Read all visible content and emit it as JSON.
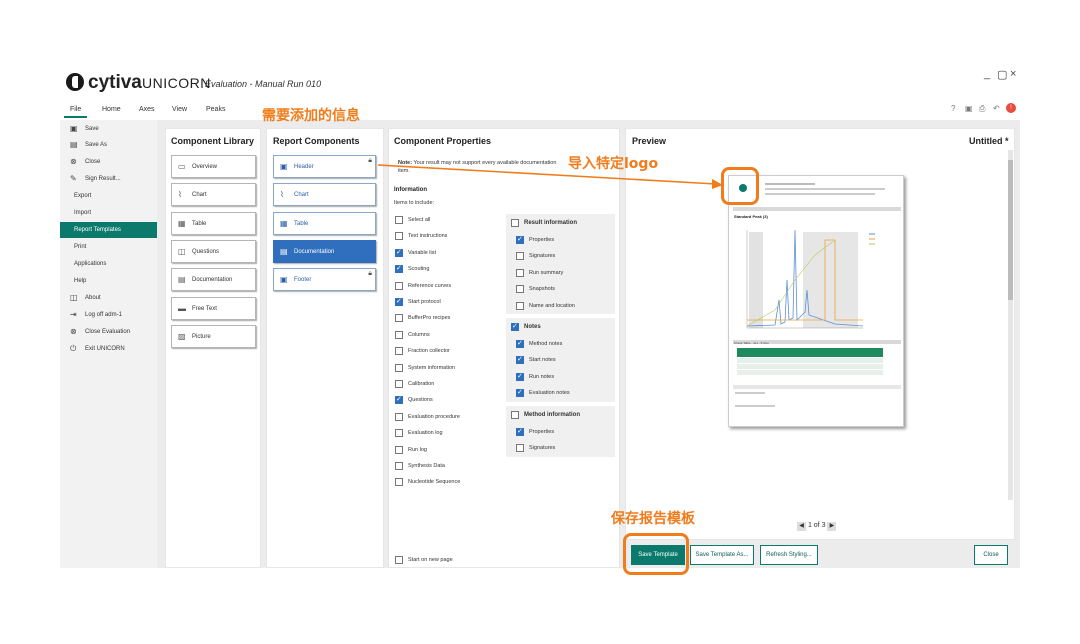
{
  "app": {
    "brand": "cytiva",
    "product": "UNICORN",
    "window_title": "Evaluation - Manual Run  010",
    "window_controls": [
      "_",
      "▢",
      "×"
    ]
  },
  "menu": [
    "File",
    "Home",
    "Axes",
    "View",
    "Peaks"
  ],
  "sidebar": [
    {
      "label": "Save",
      "icon": "save-icon"
    },
    {
      "label": "Save As",
      "icon": "save-as-icon"
    },
    {
      "label": "Close",
      "icon": "close-circle-icon"
    },
    {
      "label": "Sign Result...",
      "icon": "pen-icon"
    },
    {
      "label": "Export",
      "icon": ""
    },
    {
      "label": "Import",
      "icon": ""
    },
    {
      "label": "Report Templates",
      "icon": "",
      "active": true
    },
    {
      "label": "Print",
      "icon": ""
    },
    {
      "label": "Applications",
      "icon": ""
    },
    {
      "label": "Help",
      "icon": ""
    },
    {
      "label": "About",
      "icon": "about-icon"
    },
    {
      "label": "Log off adm-1",
      "icon": "logoff-icon"
    },
    {
      "label": "Close Evaluation",
      "icon": "close-circle-icon"
    },
    {
      "label": "Exit UNICORN",
      "icon": "power-icon"
    }
  ],
  "component_library": {
    "title": "Component Library",
    "items": [
      "Overview",
      "Chart",
      "Table",
      "Questions",
      "Documentation",
      "Free Text",
      "Picture"
    ]
  },
  "report_components": {
    "title": "Report Components",
    "items": [
      "Header",
      "Chart",
      "Table",
      "Documentation",
      "Footer"
    ]
  },
  "component_properties": {
    "title": "Component Properties",
    "note_label": "Note:",
    "note_text": "Your result may not support every available documentation item.",
    "section": "Information",
    "items_label": "Items to include:",
    "items": [
      {
        "label": "Select all",
        "checked": false
      },
      {
        "label": "Text instructions",
        "checked": false
      },
      {
        "label": "Variable list",
        "checked": true
      },
      {
        "label": "Scouting",
        "checked": true
      },
      {
        "label": "Reference curves",
        "checked": false
      },
      {
        "label": "Start protocol",
        "checked": true
      },
      {
        "label": "BufferPro recipes",
        "checked": false
      },
      {
        "label": "Columns",
        "checked": false
      },
      {
        "label": "Fraction collector",
        "checked": false
      },
      {
        "label": "System information",
        "checked": false
      },
      {
        "label": "Calibration",
        "checked": false
      },
      {
        "label": "Questions",
        "checked": true
      },
      {
        "label": "Evaluation procedure",
        "checked": false
      },
      {
        "label": "Evaluation log",
        "checked": false
      },
      {
        "label": "Run log",
        "checked": false
      },
      {
        "label": "Synthesis Data",
        "checked": false
      },
      {
        "label": "Nucleotide Sequence",
        "checked": false
      }
    ],
    "groups": [
      {
        "title": "Result information",
        "checked": false,
        "items": [
          {
            "label": "Properties",
            "checked": true
          },
          {
            "label": "Signatures",
            "checked": false
          },
          {
            "label": "Run summary",
            "checked": false
          },
          {
            "label": "Snapshots",
            "checked": false
          },
          {
            "label": "Name and location",
            "checked": false
          }
        ]
      },
      {
        "title": "Notes",
        "checked": true,
        "items": [
          {
            "label": "Method notes",
            "checked": true
          },
          {
            "label": "Start notes",
            "checked": true
          },
          {
            "label": "Run notes",
            "checked": true
          },
          {
            "label": "Evaluation notes",
            "checked": true
          }
        ]
      },
      {
        "title": "Method information",
        "checked": false,
        "items": [
          {
            "label": "Properties",
            "checked": true
          },
          {
            "label": "Signatures",
            "checked": false
          }
        ]
      }
    ],
    "start_new_page": "Start on new page"
  },
  "preview": {
    "title": "Preview",
    "doc_name": "Untitled *",
    "pager": "1 of 3",
    "page_heading": "Standard Peak (3)",
    "table_heading": "Check Table - 4x1 - 5.3ms"
  },
  "buttons": {
    "save_template": "Save Template",
    "save_template_as": "Save Template As...",
    "refresh_styling": "Refresh Styling...",
    "close": "Close"
  },
  "annotations": {
    "info_to_add": "需要添加的信息",
    "import_logo": "导入特定logo",
    "save_template": "保存报告模板"
  },
  "colors": {
    "accent": "#0b7a6c",
    "select_blue": "#2f6fbd",
    "annotation": "#f07c1c"
  }
}
